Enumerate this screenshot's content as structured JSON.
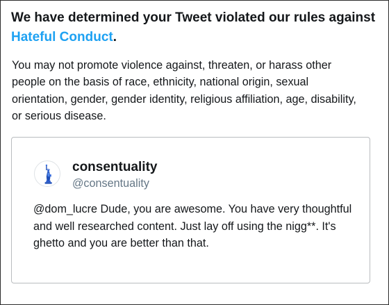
{
  "violation": {
    "headline_prefix": "We have determined your Tweet violated our rules against ",
    "rule_name": "Hateful Conduct",
    "headline_suffix": ".",
    "description": "You may not promote violence against, threaten, or harass other people on the basis of race, ethnicity, national origin, sexual orientation, gender, gender identity, religious affiliation, age, disability, or serious disease.",
    "rule_link_color": "#1da1f2"
  },
  "tweet": {
    "display_name": "consentuality",
    "handle": "@consentuality",
    "avatar_icon": "statue-of-liberty-icon",
    "text": "@dom_lucre Dude, you are awesome. You have very thoughtful and well researched content. Just lay off using the nigg**. It's ghetto and you are better than that."
  }
}
